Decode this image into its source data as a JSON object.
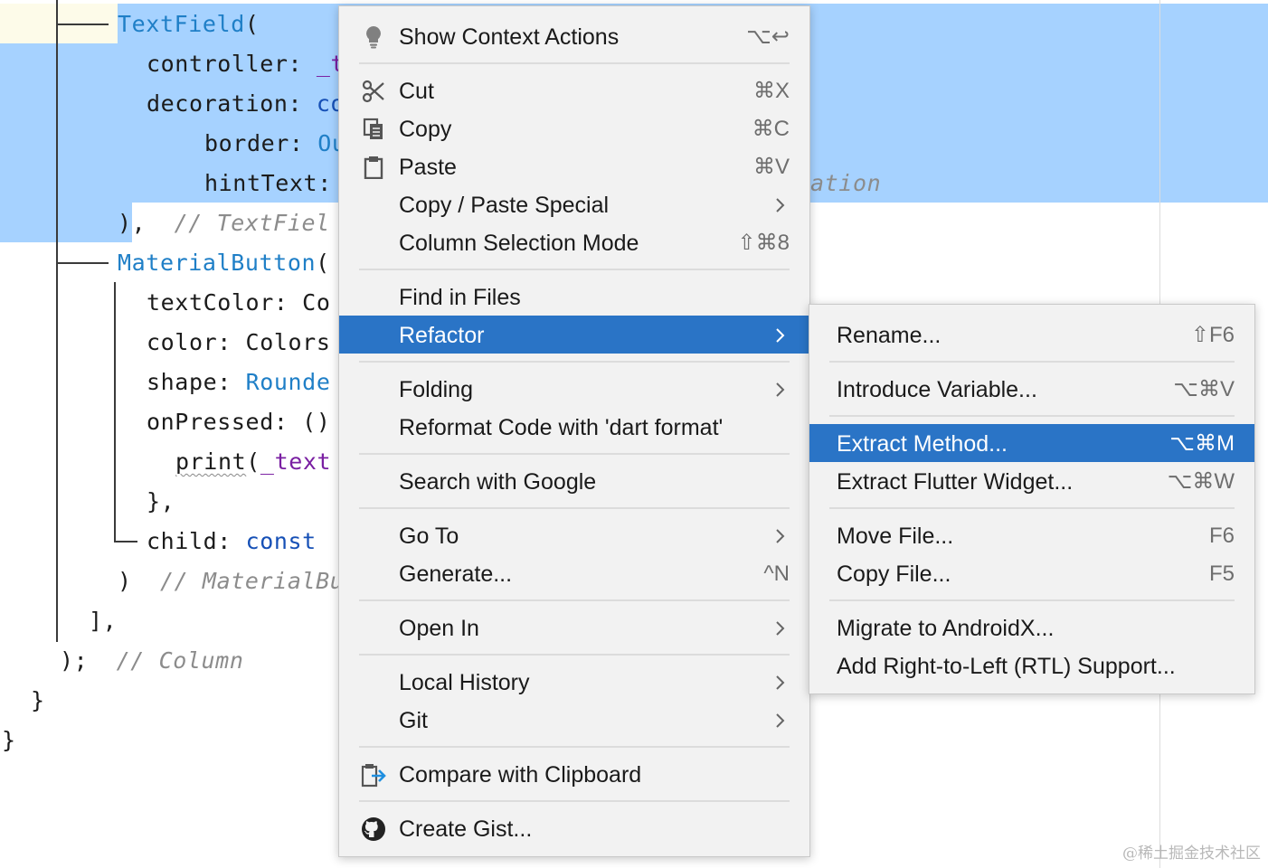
{
  "editor": {
    "lines": [
      {
        "segments": [
          {
            "t": "TextField",
            "c": "cls"
          },
          {
            "t": "("
          }
        ]
      },
      {
        "segments": [
          {
            "t": "controller: "
          },
          {
            "t": "_t",
            "c": "fld"
          }
        ]
      },
      {
        "segments": [
          {
            "t": "decoration: "
          },
          {
            "t": "co",
            "c": "kw"
          }
        ]
      },
      {
        "segments": [
          {
            "t": "border: "
          },
          {
            "t": "Ou",
            "c": "cls"
          }
        ]
      },
      {
        "segments": [
          {
            "t": "hintText: "
          }
        ]
      },
      {
        "segments": [
          {
            "t": "),  "
          },
          {
            "t": "// TextFiel",
            "c": "cm"
          }
        ]
      },
      {
        "segments": [
          {
            "t": "MaterialButton",
            "c": "cls"
          },
          {
            "t": "("
          }
        ]
      },
      {
        "segments": [
          {
            "t": "textColor: Co"
          }
        ]
      },
      {
        "segments": [
          {
            "t": "color: Colors"
          }
        ]
      },
      {
        "segments": [
          {
            "t": "shape: "
          },
          {
            "t": "Rounde",
            "c": "cls"
          }
        ]
      },
      {
        "segments": [
          {
            "t": "onPressed: ()"
          }
        ]
      },
      {
        "segments": [
          {
            "t": "print",
            "c": "squig"
          },
          {
            "t": "("
          },
          {
            "t": "_text",
            "c": "fld"
          }
        ]
      },
      {
        "segments": [
          {
            "t": "},"
          }
        ]
      },
      {
        "segments": [
          {
            "t": "child: "
          },
          {
            "t": "const",
            "c": "kw"
          }
        ]
      },
      {
        "segments": [
          {
            "t": ")  "
          },
          {
            "t": "// MaterialBu",
            "c": "cm"
          }
        ]
      },
      {
        "segments": [
          {
            "t": "],"
          }
        ]
      },
      {
        "segments": [
          {
            "t": ");  "
          },
          {
            "t": "// Column",
            "c": "cm"
          }
        ]
      },
      {
        "segments": [
          {
            "t": "}"
          }
        ]
      },
      {
        "segments": [
          {
            "t": "}"
          }
        ]
      }
    ],
    "hint_tail": "ation",
    "watermark": "@稀土掘金技术社区"
  },
  "context_menu": {
    "items": [
      {
        "label": "Show Context Actions",
        "shortcut": "⌥↩",
        "icon": "lightbulb-icon"
      },
      {
        "label": "Cut",
        "shortcut": "⌘X",
        "icon": "scissors-icon"
      },
      {
        "label": "Copy",
        "shortcut": "⌘C",
        "icon": "copy-icon"
      },
      {
        "label": "Paste",
        "shortcut": "⌘V",
        "icon": "clipboard-icon"
      },
      {
        "label": "Copy / Paste Special",
        "submenu": true
      },
      {
        "label": "Column Selection Mode",
        "shortcut": "⇧⌘8"
      },
      {
        "label": "Find in Files"
      },
      {
        "label": "Refactor",
        "submenu": true,
        "active": true
      },
      {
        "label": "Folding",
        "submenu": true
      },
      {
        "label": "Reformat Code with 'dart format'"
      },
      {
        "label": "Search with Google"
      },
      {
        "label": "Go To",
        "submenu": true
      },
      {
        "label": "Generate...",
        "shortcut": "^N"
      },
      {
        "label": "Open In",
        "submenu": true
      },
      {
        "label": "Local History",
        "submenu": true
      },
      {
        "label": "Git",
        "submenu": true
      },
      {
        "label": "Compare with Clipboard",
        "icon": "compare-clipboard-icon"
      },
      {
        "label": "Create Gist...",
        "icon": "github-icon"
      }
    ]
  },
  "refactor_submenu": {
    "items": [
      {
        "label": "Rename...",
        "shortcut": "⇧F6"
      },
      {
        "label": "Introduce Variable...",
        "shortcut": "⌥⌘V"
      },
      {
        "label": "Extract Method...",
        "shortcut": "⌥⌘M",
        "active": true
      },
      {
        "label": "Extract Flutter Widget...",
        "shortcut": "⌥⌘W"
      },
      {
        "label": "Move File...",
        "shortcut": "F6"
      },
      {
        "label": "Copy File...",
        "shortcut": "F5"
      },
      {
        "label": "Migrate to AndroidX..."
      },
      {
        "label": "Add Right-to-Left (RTL) Support..."
      }
    ]
  },
  "colors": {
    "selection": "#a6d2ff",
    "menu_background": "#f2f2f2",
    "menu_highlight": "#2a74c6",
    "class_name": "#1f7fc7",
    "comment": "#8c8c8c"
  }
}
